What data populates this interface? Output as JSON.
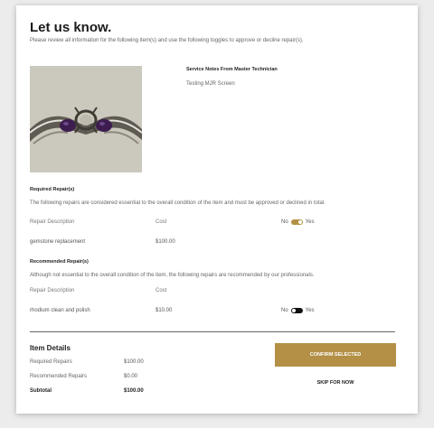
{
  "header": {
    "title": "Let us know.",
    "intro": "Please review all information for the following item(s) and use the following toggles to approve or decline repair(s)."
  },
  "item": {
    "image_icon": "ring-photo",
    "notes_title": "Service Notes From Master Technician",
    "notes_body": "Testing MJR Screen"
  },
  "required": {
    "title": "Required Repair(s)",
    "desc": "The following repairs are considered essential to the overall condition of the item and must be approved or declined in total.",
    "col_description": "Repair Description",
    "col_cost": "Cost",
    "toggle_no": "No",
    "toggle_yes": "Yes",
    "toggle_state": "yes",
    "rows": [
      {
        "description": "gemstone replacement",
        "cost": "$100.00"
      }
    ]
  },
  "recommended": {
    "title": "Recommended Repair(s)",
    "desc": "Although not essential to the overall condition of the item, the following repairs are recommended by our professionals.",
    "col_description": "Repair Description",
    "col_cost": "Cost",
    "rows": [
      {
        "description": "rhodium clean and polish",
        "cost": "$10.00",
        "toggle_no": "No",
        "toggle_yes": "Yes",
        "toggle_state": "no"
      }
    ]
  },
  "details": {
    "title": "Item Details",
    "required_label": "Required Repairs",
    "required_value": "$100.00",
    "recommended_label": "Recommended Repairs",
    "recommended_value": "$0.00",
    "subtotal_label": "Subtotal",
    "subtotal_value": "$100.00"
  },
  "actions": {
    "confirm_label": "CONFIRM SELECTED",
    "skip_label": "SKIP FOR NOW"
  },
  "colors": {
    "accent": "#b39046",
    "toggle_off": "#111111"
  }
}
